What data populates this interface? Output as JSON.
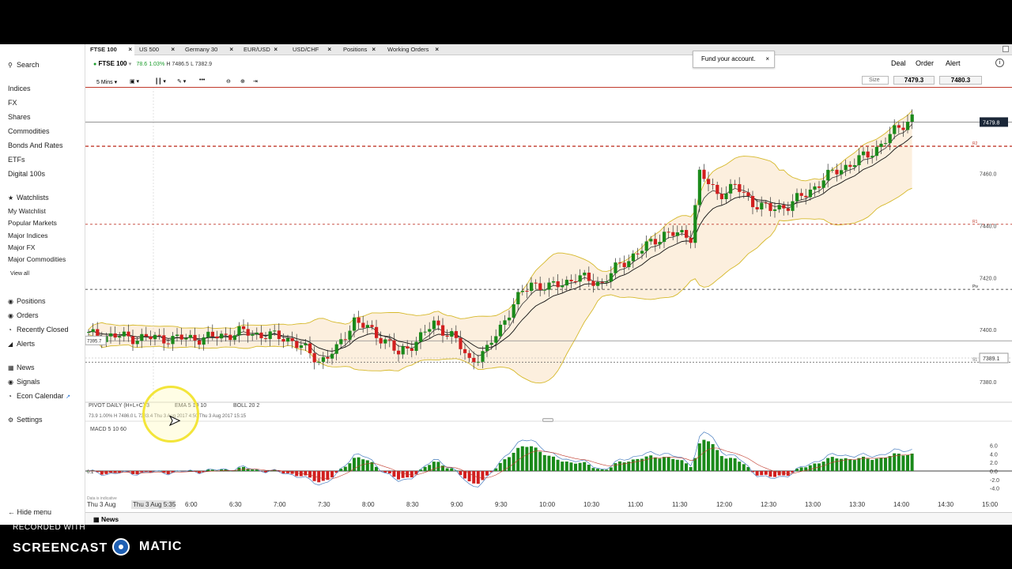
{
  "sidebar": {
    "search": "Search",
    "markets": [
      "Indices",
      "FX",
      "Shares",
      "Commodities",
      "Bonds And Rates",
      "ETFs",
      "Digital 100s"
    ],
    "watchlists_title": "Watchlists",
    "watchlists": [
      "My Watchlist",
      "Popular Markets",
      "Major Indices",
      "Major FX",
      "Major Commodities"
    ],
    "view_all": "View all",
    "account": [
      "Positions",
      "Orders",
      "Recently Closed",
      "Alerts"
    ],
    "info": [
      "News",
      "Signals",
      "Econ Calendar"
    ],
    "settings": "Settings",
    "hide_menu": "Hide menu"
  },
  "tabs": [
    "FTSE 100",
    "US 500",
    "Germany 30",
    "EUR/USD",
    "USD/CHF",
    "Positions",
    "Working Orders"
  ],
  "header": {
    "market": "FTSE 100",
    "change": "78.6",
    "pct": "1.03%",
    "high": "H 7486.5",
    "low": "L 7382.9",
    "fund_text": "Fund your account.",
    "deal": "Deal",
    "order": "Order",
    "alert": "Alert",
    "size_label": "Size",
    "sell_price": "7479.3",
    "buy_price": "7480.3"
  },
  "toolbar": {
    "interval": "5 Mins"
  },
  "chart_data": {
    "type": "candlestick",
    "instrument": "FTSE 100",
    "interval": "5 Mins",
    "y_axis_ticks": [
      7460.0,
      7440.0,
      7420.0,
      7400.0,
      7380.0
    ],
    "ylim": [
      7373,
      7493
    ],
    "x_ticks": [
      "Thu 3 Aug",
      "Thu 3 Aug 5:35",
      "6:00",
      "6:30",
      "7:00",
      "7:30",
      "8:00",
      "8:30",
      "9:00",
      "9:30",
      "10:00",
      "10:30",
      "11:00",
      "11:30",
      "12:00",
      "12:30",
      "13:00",
      "13:30",
      "14:00",
      "14:30",
      "15:00"
    ],
    "current_price_label": "7479.8",
    "left_price_label": "7395.7",
    "crosshair_price_label": "7389.1",
    "pivot_labels": [
      "R2",
      "R1",
      "Piv",
      "S1"
    ],
    "pivot_values": [
      7470.5,
      7440.5,
      7415.5,
      7387.5
    ],
    "indicator_legend": {
      "pivot": "PIVOT  DAILY  (H+L+C)/3",
      "ema": "EMA  5  10  10",
      "boll": "BOLL  20  2",
      "info_line": "73.9   1.00%   H 7486.0   L 7383.4   Thu 3 Aug 2017 4:50   Thu 3 Aug 2017 15:15"
    },
    "macd": {
      "label": "MACD  5  10  60",
      "y_ticks": [
        "6.0",
        "4.0",
        "2.0",
        "0.0",
        "-2.0",
        "-4.0"
      ],
      "left_label": "0.1"
    },
    "data_note": "Data is indicative"
  },
  "news_tab": "News",
  "watermark": {
    "recorded": "RECORDED WITH",
    "left": "SCREENCAST",
    "right": "MATIC"
  }
}
